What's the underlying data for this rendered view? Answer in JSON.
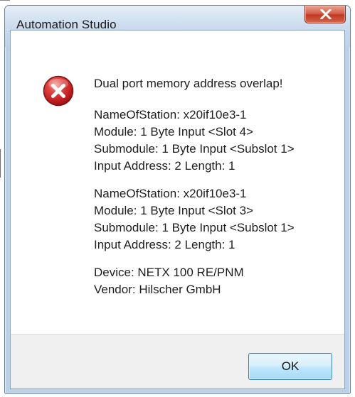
{
  "window": {
    "title": "Automation Studio",
    "close_label": "X"
  },
  "dialog": {
    "icon": "error-icon",
    "heading": "Dual port memory address overlap!",
    "blocks": [
      {
        "lines": [
          "NameOfStation: x20if10e3-1",
          "Module: 1 Byte Input <Slot 4>",
          "Submodule: 1 Byte Input <Subslot 1>",
          "Input Address: 2 Length: 1"
        ]
      },
      {
        "lines": [
          "NameOfStation: x20if10e3-1",
          "Module: 1 Byte Input <Slot 3>",
          "Submodule: 1 Byte Input <Subslot 1>",
          "Input Address: 2 Length: 1"
        ]
      },
      {
        "lines": [
          "Device: NETX 100 RE/PNM",
          "Vendor: Hilscher GmbH"
        ]
      }
    ],
    "ok_label": "OK"
  },
  "colors": {
    "close_button": "#c9452c",
    "error_icon": "#c8272a",
    "ok_border": "#3c7fb1"
  }
}
